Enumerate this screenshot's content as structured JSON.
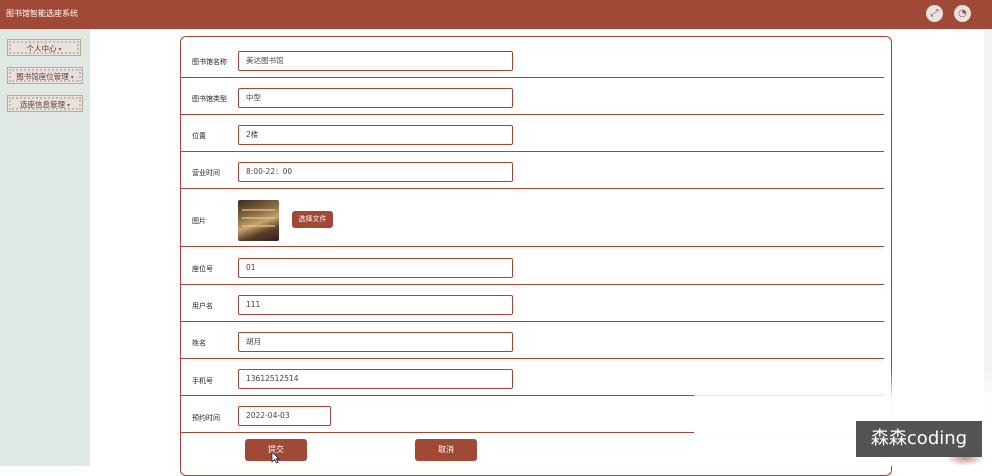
{
  "app": {
    "title": "图书馆智能选座系统"
  },
  "header": {
    "icons": [
      {
        "name": "fullscreen-icon"
      },
      {
        "name": "user-avatar-icon"
      }
    ]
  },
  "sidebar": {
    "items": [
      {
        "label": "个人中心"
      },
      {
        "label": "图书馆座位管理"
      },
      {
        "label": "选座信息管理"
      }
    ]
  },
  "form": {
    "fields": [
      {
        "label": "图书馆名称",
        "value": "美达图书馆"
      },
      {
        "label": "图书馆类型",
        "value": "中型"
      },
      {
        "label": "位置",
        "value": "2楼"
      },
      {
        "label": "营业时间",
        "value": "8:00-22：00"
      },
      {
        "label": "图片"
      },
      {
        "label": "座位号",
        "value": "01"
      },
      {
        "label": "用户名",
        "value": "111"
      },
      {
        "label": "姓名",
        "value": "胡月"
      },
      {
        "label": "手机号",
        "value": "13612512514"
      },
      {
        "label": "预约时间",
        "value": "2022-04-03"
      }
    ],
    "file_button_label": "选择文件",
    "submit_label": "提交",
    "cancel_label": "取消"
  },
  "watermark": {
    "text": "森森coding"
  },
  "colors": {
    "primary": "#a04936",
    "sidebar_bg": "#dfe8e2",
    "topbar_text": "#ffffff"
  }
}
